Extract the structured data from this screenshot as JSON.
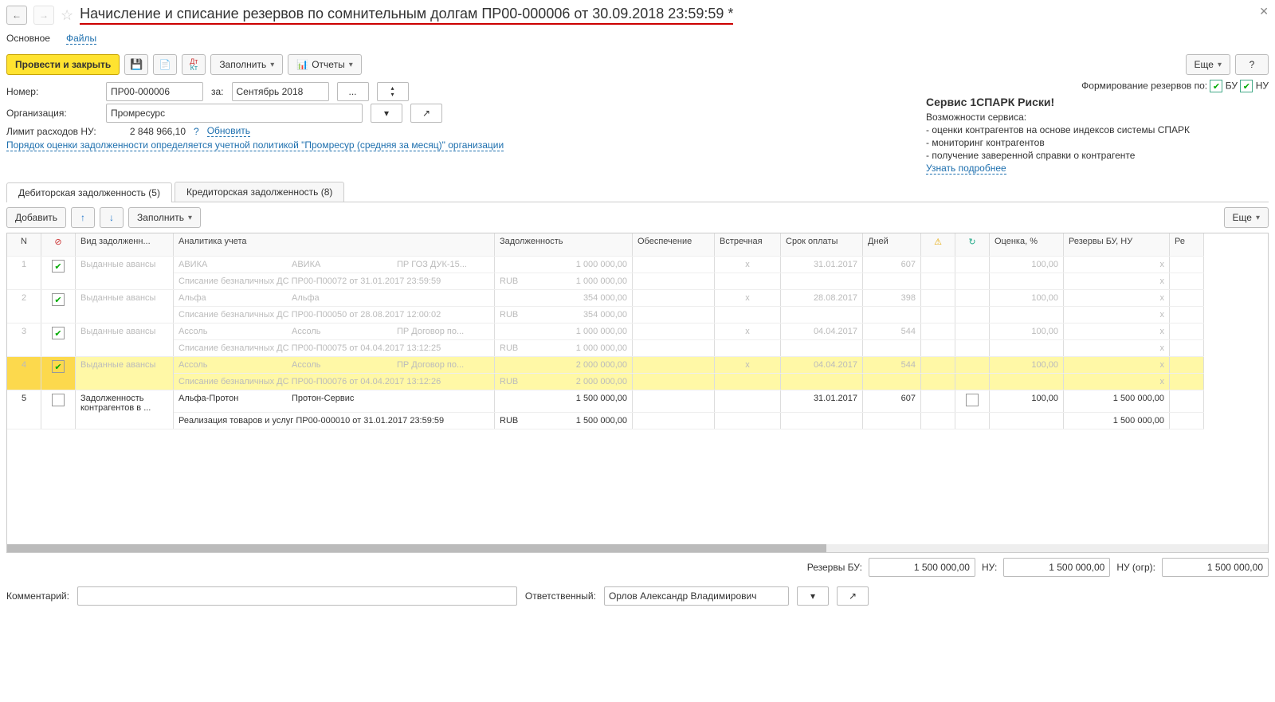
{
  "title": "Начисление и списание резервов по сомнительным долгам ПР00-000006 от 30.09.2018 23:59:59 *",
  "tabs1": {
    "main": "Основное",
    "files": "Файлы"
  },
  "toolbar": {
    "post_close": "Провести и закрыть",
    "fill": "Заполнить",
    "reports": "Отчеты",
    "more": "Еще",
    "help": "?"
  },
  "form": {
    "number_label": "Номер:",
    "number": "ПР00-000006",
    "period_label": "за:",
    "period": "Сентябрь 2018",
    "period_pick": "...",
    "org_label": "Организация:",
    "org": "Промресурс",
    "limit_label": "Лимит расходов НУ:",
    "limit": "2 848 966,10",
    "update": "Обновить",
    "q": "?",
    "policy": "Порядок оценки задолженности определяется учетной политикой \"Промресур (средняя за месяц)\" организации"
  },
  "rightpanel": {
    "reserves_label": "Формирование резервов по:",
    "chk_bu": "БУ",
    "chk_nu": "НУ",
    "spark_title": "Сервис 1СПАРК Риски!",
    "spark_sub": "Возможности сервиса:",
    "spark_l1": "- оценки контрагентов на основе индексов системы СПАРК",
    "spark_l2": "- мониторинг контрагентов",
    "spark_l3": "- получение заверенной справки о контрагенте",
    "spark_more": "Узнать подробнее"
  },
  "tabs2": {
    "debit": "Дебиторская задолженность (5)",
    "credit": "Кредиторская задолженность (8)"
  },
  "list_toolbar": {
    "add": "Добавить",
    "fill": "Заполнить",
    "more": "Еще"
  },
  "columns": {
    "n": "N",
    "skip": "",
    "type": "Вид задолженн...",
    "analytics": "Аналитика учета",
    "debt": "Задолженность",
    "secure": "Обеспечение",
    "counter": "Встречная",
    "due": "Срок оплаты",
    "days": "Дней",
    "warn": "⚠",
    "refresh": "↻",
    "pct": "Оценка, %",
    "reserve": "Резервы БУ, НУ",
    "extra": "Ре"
  },
  "rows": [
    {
      "n": "1",
      "checked": true,
      "dim": true,
      "type": "Выданные авансы",
      "analytics1": [
        "АВИКА",
        "АВИКА",
        "ПР ГОЗ ДУК-15..."
      ],
      "debt1": "1 000 000,00",
      "analytics2": "Списание безналичных ДС ПР00-П00072 от 31.01.2017 23:59:59",
      "cur": "RUB",
      "debt2": "1 000 000,00",
      "counter": "x",
      "due": "31.01.2017",
      "days": "607",
      "pct": "100,00",
      "res1": "x",
      "res2": "x"
    },
    {
      "n": "2",
      "checked": true,
      "dim": true,
      "type": "Выданные авансы",
      "analytics1": [
        "Альфа",
        "Альфа",
        ""
      ],
      "debt1": "354 000,00",
      "analytics2": "Списание безналичных ДС ПР00-П00050 от 28.08.2017 12:00:02",
      "cur": "RUB",
      "debt2": "354 000,00",
      "counter": "x",
      "due": "28.08.2017",
      "days": "398",
      "pct": "100,00",
      "res1": "x",
      "res2": "x"
    },
    {
      "n": "3",
      "checked": true,
      "dim": true,
      "type": "Выданные авансы",
      "analytics1": [
        "Ассоль",
        "Ассоль",
        "ПР Договор по..."
      ],
      "debt1": "1 000 000,00",
      "analytics2": "Списание безналичных ДС ПР00-П00075 от 04.04.2017 13:12:25",
      "cur": "RUB",
      "debt2": "1 000 000,00",
      "counter": "x",
      "due": "04.04.2017",
      "days": "544",
      "pct": "100,00",
      "res1": "x",
      "res2": "x"
    },
    {
      "n": "4",
      "checked": true,
      "dim": true,
      "hl": true,
      "type": "Выданные авансы",
      "analytics1": [
        "Ассоль",
        "Ассоль",
        "ПР Договор по..."
      ],
      "debt1": "2 000 000,00",
      "analytics2": "Списание безналичных ДС ПР00-П00076 от 04.04.2017 13:12:26",
      "cur": "RUB",
      "debt2": "2 000 000,00",
      "counter": "x",
      "due": "04.04.2017",
      "days": "544",
      "pct": "100,00",
      "res1": "x",
      "res2": "x"
    },
    {
      "n": "5",
      "checked": false,
      "dim": false,
      "type": "Задолженность контрагентов в ...",
      "analytics1": [
        "Альфа-Протон",
        "Протон-Сервис",
        ""
      ],
      "debt1": "1 500 000,00",
      "analytics2": "Реализация товаров и услуг ПР00-000010 от 31.01.2017 23:59:59",
      "cur": "RUB",
      "debt2": "1 500 000,00",
      "counter": "",
      "due": "31.01.2017",
      "days": "607",
      "refresh_chk": true,
      "pct": "100,00",
      "res1": "1 500 000,00",
      "res2": "1 500 000,00"
    }
  ],
  "totals": {
    "bu_label": "Резервы БУ:",
    "bu": "1 500 000,00",
    "nu_label": "НУ:",
    "nu": "1 500 000,00",
    "nu_lim_label": "НУ (огр):",
    "nu_lim": "1 500 000,00"
  },
  "footer": {
    "comment_label": "Комментарий:",
    "resp_label": "Ответственный:",
    "resp": "Орлов Александр Владимирович"
  }
}
